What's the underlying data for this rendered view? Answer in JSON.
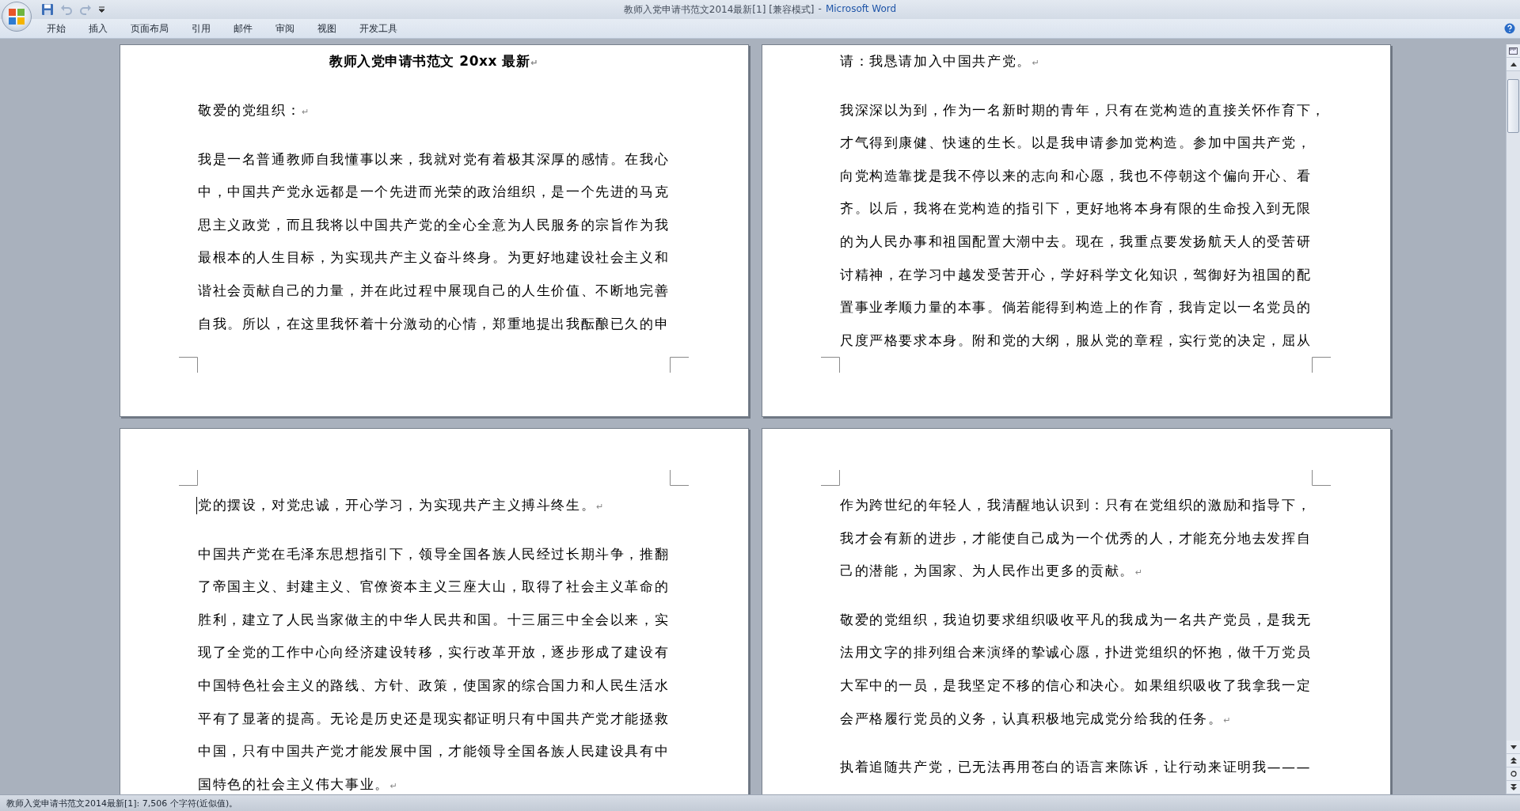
{
  "window": {
    "title": "教师入党申请书范文2014最新[1] [兼容模式]",
    "separator": "-",
    "app_name": "Microsoft Word"
  },
  "quick_access": [
    {
      "kind": "save",
      "disabled": false
    },
    {
      "kind": "undo",
      "disabled": true
    },
    {
      "kind": "redo",
      "disabled": true
    },
    {
      "kind": "customize",
      "disabled": false
    }
  ],
  "ribbon_tabs": [
    {
      "label": "开始",
      "selected": false
    },
    {
      "label": "插入",
      "selected": false
    },
    {
      "label": "页面布局",
      "selected": false
    },
    {
      "label": "引用",
      "selected": false
    },
    {
      "label": "邮件",
      "selected": false
    },
    {
      "label": "审阅",
      "selected": false
    },
    {
      "label": "视图",
      "selected": false
    },
    {
      "label": "开发工具",
      "selected": false
    }
  ],
  "pages": [
    {
      "crop_marks_top": false,
      "blocks": [
        {
          "kind": "heading",
          "lines": [
            "教师入党申请书范文 20xx 最新"
          ],
          "mark": "↵"
        },
        {
          "kind": "paragraph",
          "lines": [
            "敬爱的党组织："
          ],
          "mark": "↵"
        },
        {
          "kind": "paragraph",
          "lines": [
            "我是一名普通教师自我懂事以来，我就对党有着极其深厚的感情。在我心",
            "中，中国共产党永远都是一个先进而光荣的政治组织，是一个先进的马克",
            "思主义政党，而且我将以中国共产党的全心全意为人民服务的宗旨作为我",
            "最根本的人生目标，为实现共产主义奋斗终身。为更好地建设社会主义和",
            "谐社会贡献自己的力量，并在此过程中展现自己的人生价值、不断地完善",
            "自我。所以，在这里我怀着十分激动的心情，郑重地提出我酝酿已久的申"
          ]
        }
      ]
    },
    {
      "crop_marks_top": false,
      "blocks": [
        {
          "kind": "paragraph",
          "lines": [
            "请：我恳请加入中国共产党。"
          ],
          "mark": "↵"
        },
        {
          "kind": "paragraph",
          "lines": [
            "我深深以为到，作为一名新时期的青年，只有在党构造的直接关怀作育下，",
            "才气得到康健、快速的生长。以是我申请参加党构造。参加中国共产党，",
            "向党构造靠拢是我不停以来的志向和心愿，我也不停朝这个偏向开心、看",
            "齐。以后，我将在党构造的指引下，更好地将本身有限的生命投入到无限",
            "的为人民办事和祖国配置大潮中去。现在，我重点要发扬航天人的受苦研",
            "讨精神，在学习中越发受苦开心，学好科学文化知识，驾御好为祖国的配",
            "置事业孝顺力量的本事。倘若能得到构造上的作育，我肯定以一名党员的",
            "尺度严格要求本身。附和党的大纲，服从党的章程，实行党的决定，屈从"
          ]
        }
      ]
    },
    {
      "crop_marks_top": true,
      "blocks": [
        {
          "kind": "paragraph",
          "lines": [
            "党的摆设，对党忠诚，开心学习，为实现共产主义搏斗终生。"
          ],
          "mark": "↵",
          "caret": true
        },
        {
          "kind": "paragraph",
          "lines": [
            "中国共产党在毛泽东思想指引下，领导全国各族人民经过长期斗争，推翻",
            "了帝国主义、封建主义、官僚资本主义三座大山，取得了社会主义革命的",
            "胜利，建立了人民当家做主的中华人民共和国。十三届三中全会以来，实",
            "现了全党的工作中心向经济建设转移，实行改革开放，逐步形成了建设有",
            "中国特色社会主义的路线、方针、政策，使国家的综合国力和人民生活水",
            "平有了显著的提高。无论是历史还是现实都证明只有中国共产党才能拯救",
            "中国，只有中国共产党才能发展中国，才能领导全国各族人民建设具有中",
            "国特色的社会主义伟大事业。"
          ],
          "mark": "↵"
        }
      ]
    },
    {
      "crop_marks_top": true,
      "blocks": [
        {
          "kind": "paragraph",
          "lines": [
            "作为跨世纪的年轻人，我清醒地认识到：只有在党组织的激励和指导下，",
            "我才会有新的进步，才能使自己成为一个优秀的人，才能充分地去发挥自",
            "己的潜能，为国家、为人民作出更多的贡献。"
          ],
          "mark": "↵"
        },
        {
          "kind": "paragraph",
          "lines": [
            "敬爱的党组织，我迫切要求组织吸收平凡的我成为一名共产党员，是我无",
            "法用文字的排列组合来演绎的挚诚心愿，扑进党组织的怀抱，做千万党员",
            "大军中的一员，是我坚定不移的信心和决心。如果组织吸收了我拿我一定",
            "会严格履行党员的义务，认真积极地完成党分给我的任务。"
          ],
          "mark": "↵"
        },
        {
          "kind": "paragraph",
          "lines": [
            "执着追随共产党，已无法再用苍白的语言来陈诉，让行动来证明我———"
          ]
        }
      ]
    }
  ],
  "status_bar": {
    "text": "教师入党申请书范文2014最新[1]: 7,506 个字符(近似值)。"
  }
}
